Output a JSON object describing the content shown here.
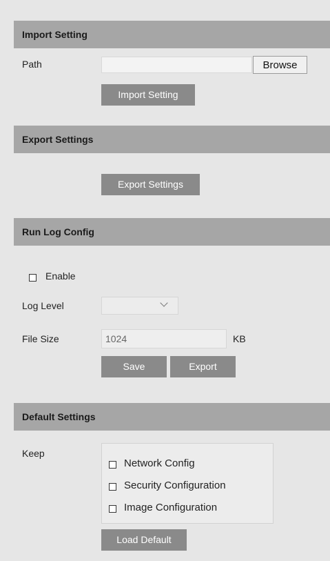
{
  "import": {
    "header": "Import Setting",
    "path_label": "Path",
    "path_value": "",
    "browse_label": "Browse",
    "button_label": "Import Setting"
  },
  "export": {
    "header": "Export Settings",
    "button_label": "Export Settings"
  },
  "runlog": {
    "header": "Run Log Config",
    "enable_label": "Enable",
    "enable_checked": false,
    "log_level_label": "Log Level",
    "log_level_value": "",
    "file_size_label": "File Size",
    "file_size_value": "1024",
    "file_size_unit": "KB",
    "save_label": "Save",
    "export_label": "Export"
  },
  "defaults": {
    "header": "Default Settings",
    "keep_label": "Keep",
    "options": [
      {
        "label": "Network Config",
        "checked": false
      },
      {
        "label": "Security Configuration",
        "checked": false
      },
      {
        "label": "Image Configuration",
        "checked": false
      }
    ],
    "load_label": "Load Default"
  },
  "colors": {
    "page_bg": "#e6e6e6",
    "header_bg": "#a6a6a6",
    "button_bg": "#8a8a8a",
    "button_text": "#ffffff"
  }
}
